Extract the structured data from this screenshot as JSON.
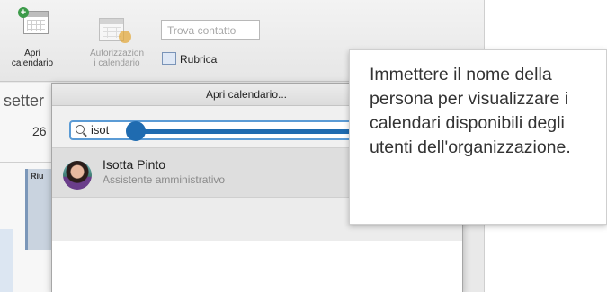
{
  "ribbon": {
    "open_calendar_label": "Apri\ncalendario",
    "permissions_label": "Autorizzazion\ni calendario",
    "contact_search_placeholder": "Trova contatto",
    "address_book_label": "Rubrica"
  },
  "calendar": {
    "month": "setter",
    "day": "26",
    "event_title": "Riu"
  },
  "dialog": {
    "title": "Apri calendario...",
    "search_value": "isot",
    "results": [
      {
        "name": "Isotta Pinto",
        "role": "Assistente amministrativo"
      }
    ]
  },
  "callout": {
    "text": "Immettere il nome della persona per visualizzare i calendari disponibili degli utenti dell'organizzazione."
  },
  "colors": {
    "accent": "#1f6bb0",
    "focus": "#5b9bd5",
    "add_badge": "#3d9b4a"
  }
}
